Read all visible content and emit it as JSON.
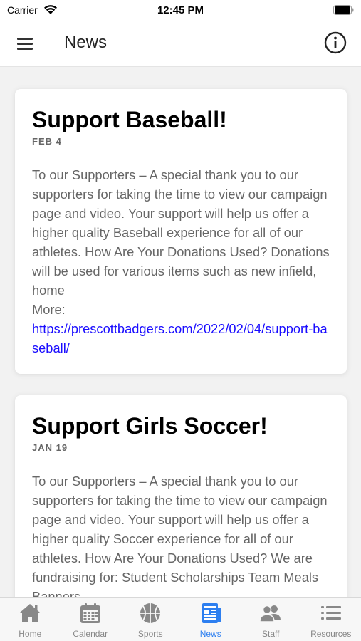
{
  "status_bar": {
    "carrier": "Carrier",
    "time": "12:45 PM"
  },
  "header": {
    "title": "News"
  },
  "posts": [
    {
      "title": "Support Baseball!",
      "date": "FEB 4",
      "body": "To our Supporters – A special thank you to our supporters for taking the time to view our campaign page and video. Your support will help us offer a higher quality Baseball experience for all of our athletes. How Are Your Donations Used? Donations will be used for various items such as new infield, home",
      "more_label": "More:",
      "link": "https://prescottbadgers.com/2022/02/04/support-baseball/"
    },
    {
      "title": "Support Girls Soccer!",
      "date": "JAN 19",
      "body": "To our Supporters – A special thank you to our supporters for taking the time to view our campaign page and video. Your support will help us offer a higher quality Soccer experience for all of our athletes. How Are Your Donations Used? We are fundraising for: Student Scholarships Team Meals Banners"
    }
  ],
  "tabs": [
    {
      "label": "Home",
      "icon": "home-icon"
    },
    {
      "label": "Calendar",
      "icon": "calendar-icon"
    },
    {
      "label": "Sports",
      "icon": "basketball-icon"
    },
    {
      "label": "News",
      "icon": "newspaper-icon",
      "active": true
    },
    {
      "label": "Staff",
      "icon": "people-icon"
    },
    {
      "label": "Resources",
      "icon": "list-icon"
    }
  ],
  "colors": {
    "accent": "#2d7ff0",
    "link": "#1a0dff",
    "inactive_tab": "#888888"
  }
}
